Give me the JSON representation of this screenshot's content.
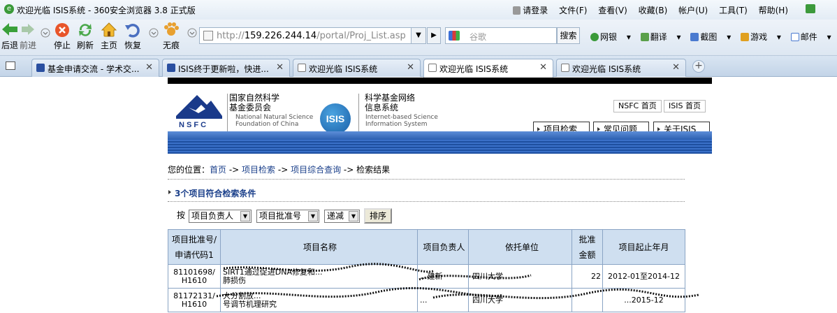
{
  "browser": {
    "window_title": "欢迎光临 ISIS系统 - 360安全浏览器 3.8 正式版",
    "menu": [
      "请登录",
      "文件(F)",
      "查看(V)",
      "收藏(B)",
      "帐户(U)",
      "工具(T)",
      "帮助(H)"
    ],
    "toolbar": {
      "back": "后退",
      "forward": "前进",
      "stop": "停止",
      "refresh": "刷新",
      "home": "主页",
      "restore": "恢复",
      "incognito": "无痕"
    },
    "address": {
      "prefix": "http://",
      "host": "159.226.244.14",
      "path": "/portal/Proj_List.asp"
    },
    "search": {
      "placeholder": "谷歌",
      "button": "搜索"
    },
    "right_tools": [
      "网银",
      "翻译",
      "截图",
      "游戏",
      "邮件"
    ],
    "tabs": [
      {
        "label": "基金申请交流 - 学术交...",
        "active": false
      },
      {
        "label": "ISIS终于更新啦，快进...",
        "active": false
      },
      {
        "label": "欢迎光临 ISIS系统",
        "active": false
      },
      {
        "label": "欢迎光临 ISIS系统",
        "active": true
      },
      {
        "label": "欢迎光临 ISIS系统",
        "active": false
      }
    ],
    "close_glyph": "✕",
    "new_tab_glyph": "+"
  },
  "site": {
    "nsfc_logo_text": "N S F C",
    "nsfc_name": [
      "国家自然科学",
      "基金委员会"
    ],
    "nsfc_en": [
      "National Natural Science",
      "Foundation of China"
    ],
    "isis_logo_text": "ISIS",
    "isis_name": [
      "科学基金网络",
      "信息系统"
    ],
    "isis_en": [
      "Internet-based Science",
      "Information System"
    ],
    "home_links": [
      "NSFC 首页",
      "ISIS 首页"
    ],
    "nav_tabs": [
      "项目检索",
      "常见问题",
      "关于ISIS"
    ]
  },
  "breadcrumb": {
    "prefix": "您的位置：",
    "items": [
      "首页",
      "项目检索",
      "项目综合查询"
    ],
    "separator": " -> ",
    "current": "检索结果"
  },
  "result_count": "3个项目符合检索条件",
  "sort": {
    "label": "按",
    "field1": "项目负责人",
    "field2": "项目批准号",
    "order": "递减",
    "button": "排序"
  },
  "table": {
    "headers": [
      "项目批准号/申请代码1",
      "项目名称",
      "项目负责人",
      "依托单位",
      "批准金额",
      "项目起止年月"
    ],
    "rows": [
      {
        "code": "81101698/",
        "sub": "H1610",
        "name": "SIRT1通过促进DNA修复和...",
        "name2": "肺损伤",
        "person": "...建新",
        "org": "四川大学",
        "amount": "22",
        "period": "2012-01至2014-12"
      },
      {
        "code": "81172131/",
        "sub": "H1610",
        "name": "大分割放...",
        "name2": "号调节机理研究",
        "person": "...",
        "org": "四川大学",
        "amount": "",
        "period": "...2015-12"
      }
    ]
  }
}
